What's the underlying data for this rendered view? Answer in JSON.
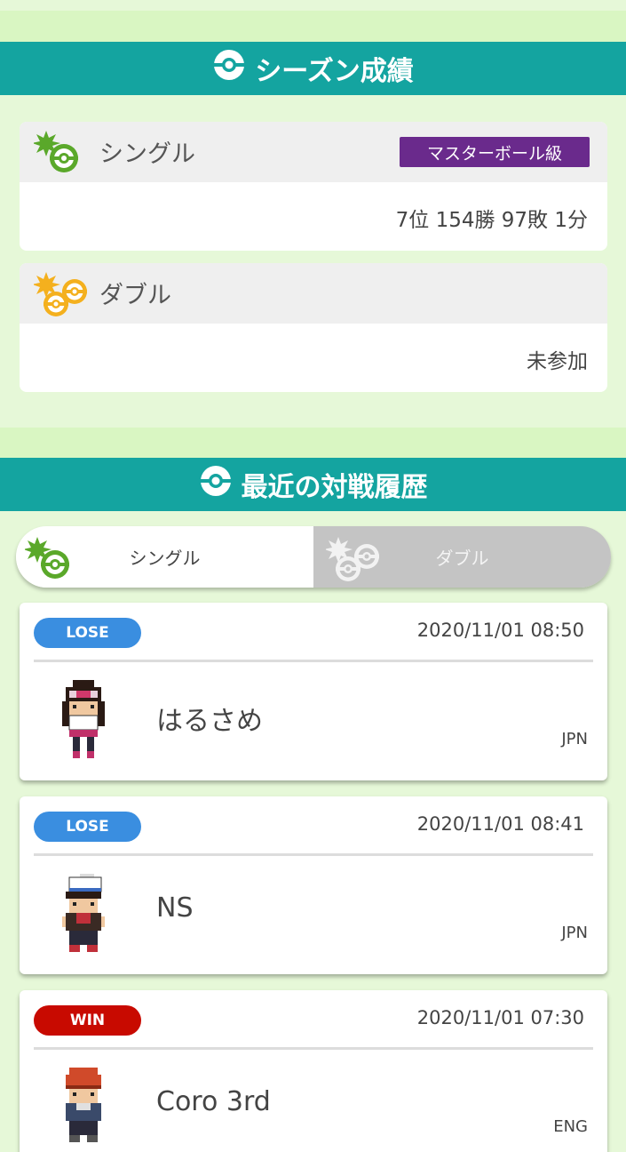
{
  "season": {
    "title": "シーズン成績",
    "single": {
      "label": "シングル",
      "rank": "マスターボール級",
      "record": "7位 154勝 97敗 1分"
    },
    "double": {
      "label": "ダブル",
      "record": "未参加"
    }
  },
  "history": {
    "title": "最近の対戦履歴",
    "tabs": {
      "single": "シングル",
      "double": "ダブル"
    },
    "battles": [
      {
        "result": "LOSE",
        "date": "2020/11/01 08:50",
        "opponent": "はるさめ",
        "country": "JPN"
      },
      {
        "result": "LOSE",
        "date": "2020/11/01 08:41",
        "opponent": "NS",
        "country": "JPN"
      },
      {
        "result": "WIN",
        "date": "2020/11/01 07:30",
        "opponent": "Coro 3rd",
        "country": "ENG"
      }
    ]
  },
  "colors": {
    "accent": "#14a4a0",
    "lose": "#3a8ee0",
    "win": "#c80a00",
    "rank": "#6a2a8c",
    "single_icon": "#5aa82a",
    "double_icon": "#f4b01e"
  }
}
